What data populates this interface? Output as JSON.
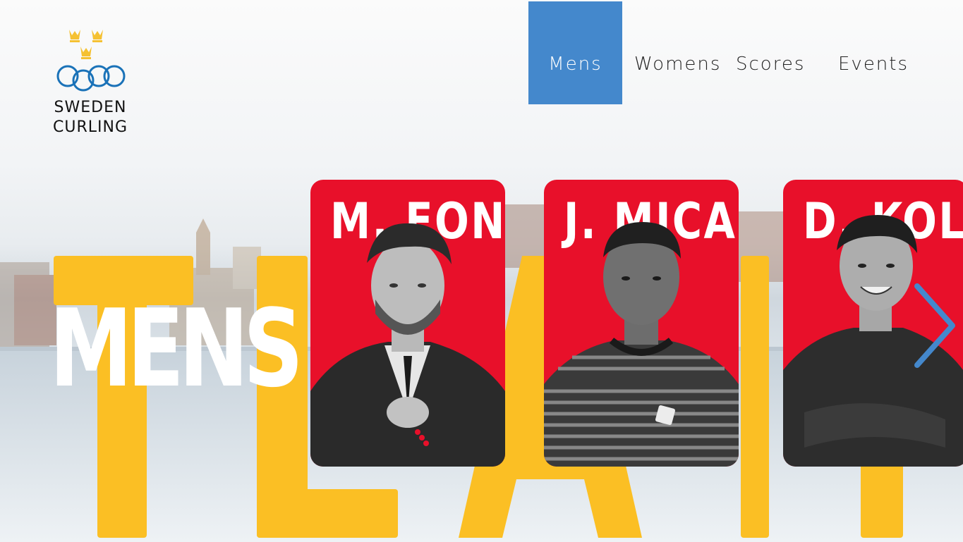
{
  "logo": {
    "line1": "SWEDEN",
    "line2": "CURLING",
    "crown_color": "#f5c132",
    "rings_color": "#1a72b8"
  },
  "nav": {
    "items": [
      {
        "label": "Mens",
        "active": true
      },
      {
        "label": "Womens",
        "active": false
      },
      {
        "label": "Scores",
        "active": false
      },
      {
        "label": "Events",
        "active": false
      }
    ],
    "active_color": "#4488cc"
  },
  "hero": {
    "heading": "MENS",
    "backdrop_word": "TEAM",
    "backdrop_color": "#fbbf24"
  },
  "players": [
    {
      "name": "M. FON"
    },
    {
      "name": "J. MICA"
    },
    {
      "name": "D. KOL"
    }
  ],
  "card_color": "#e8102a",
  "arrow_icon": "chevron-right-icon",
  "arrow_color": "#4488cc"
}
